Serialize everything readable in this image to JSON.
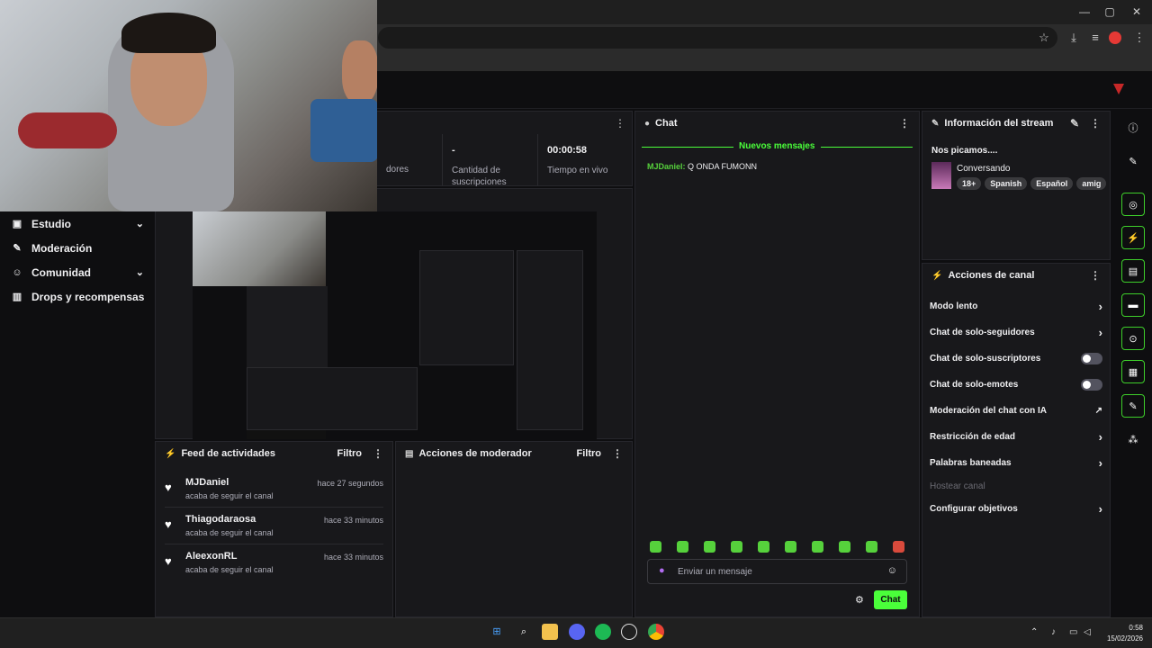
{
  "colors": {
    "accent": "#4aff3a",
    "chat_green": "#56d13c",
    "bg": "#0e0e10",
    "panel": "#18181b"
  },
  "browser": {
    "window_controls": [
      "—",
      "▢",
      "✕"
    ],
    "toolbar_icons": [
      "star-icon",
      "download-icon",
      "media-icon",
      "profile-avatar",
      "kebab-icon"
    ]
  },
  "sidebar": {
    "items": [
      {
        "label": "Estudio",
        "icon": "video-icon",
        "has_chevron": true
      },
      {
        "label": "Moderación",
        "icon": "wrench-icon",
        "has_chevron": false
      },
      {
        "label": "Comunidad",
        "icon": "people-icon",
        "has_chevron": true
      },
      {
        "label": "Drops y recompensas",
        "icon": "gift-icon",
        "has_chevron": false
      }
    ]
  },
  "stats": {
    "cells": [
      {
        "value": "",
        "label": "dores"
      },
      {
        "value": "-",
        "label": "Cantidad de suscripciones"
      },
      {
        "value": "00:00:58",
        "label": "Tiempo en vivo"
      }
    ]
  },
  "feed": {
    "title": "Feed de actividades",
    "filter": "Filtro",
    "items": [
      {
        "name": "MJDaniel",
        "sub": "acaba de seguir el canal",
        "time": "hace 27 segundos"
      },
      {
        "name": "Thiagodaraosa",
        "sub": "acaba de seguir el canal",
        "time": "hace 33 minutos"
      },
      {
        "name": "AleexonRL",
        "sub": "acaba de seguir el canal",
        "time": "hace 33 minutos"
      }
    ]
  },
  "modactions": {
    "title": "Acciones de moderador",
    "filter": "Filtro"
  },
  "chat": {
    "title": "Chat",
    "new_messages": "Nuevos mensajes",
    "messages": [
      {
        "user": "MJDaniel:",
        "text": "Q ONDA FUMONN"
      }
    ],
    "input_placeholder": "Enviar un mensaje",
    "send_label": "Chat"
  },
  "stream_info": {
    "title": "Información del stream",
    "stream_title": "Nos picamos....",
    "category": "Conversando",
    "tags": [
      "18+",
      "Spanish",
      "Español",
      "amig"
    ]
  },
  "channel_actions": {
    "title": "Acciones de canal",
    "items": [
      {
        "label": "Modo lento",
        "control": "chevron"
      },
      {
        "label": "Chat de solo-seguidores",
        "control": "chevron"
      },
      {
        "label": "Chat de solo-suscriptores",
        "control": "toggle"
      },
      {
        "label": "Chat de solo-emotes",
        "control": "toggle"
      },
      {
        "label": "Moderación del chat con IA",
        "control": "external"
      },
      {
        "label": "Restricción de edad",
        "control": "chevron"
      },
      {
        "label": "Palabras baneadas",
        "control": "chevron"
      },
      {
        "label": "Hostear canal",
        "control": "disabled"
      },
      {
        "label": "Configurar objetivos",
        "control": "chevron"
      }
    ]
  },
  "taskbar": {
    "clock_time": "0:58",
    "clock_date": "15/02/2026"
  }
}
